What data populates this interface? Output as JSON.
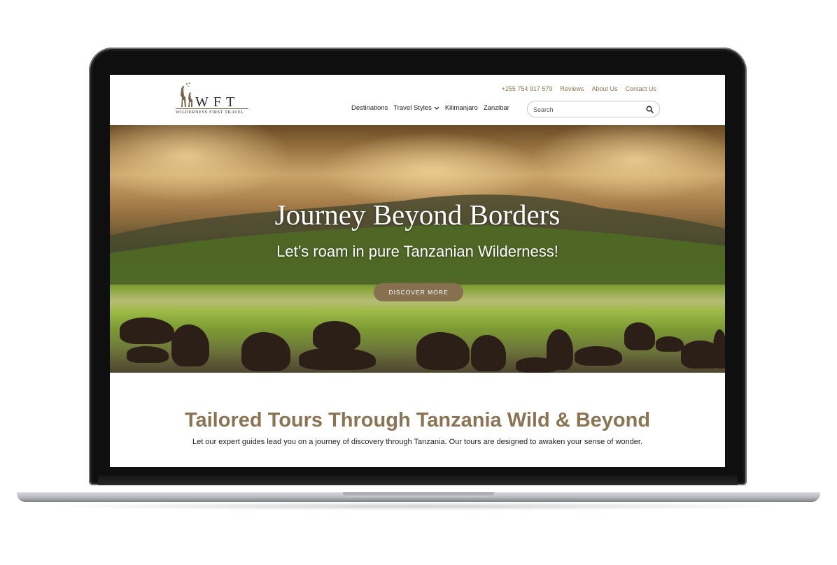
{
  "brand": {
    "logo_letters": "WFT",
    "logo_subtitle": "WILDERNESS FIRST TRAVEL",
    "accent_color": "#8a7453"
  },
  "topbar": {
    "phone": "+255 754 917 579",
    "reviews": "Reviews",
    "about": "About Us",
    "contact": "Contact Us"
  },
  "nav": {
    "destinations": "Destinations",
    "travel_styles": "Travel Styles",
    "kilimanjaro": "Kilimanjaro",
    "zanzibar": "Zanzibar"
  },
  "search": {
    "placeholder": "Search",
    "icon": "search-icon"
  },
  "hero": {
    "title": "Journey Beyond Borders",
    "subtitle": "Let’s roam in pure Tanzanian Wilderness!",
    "button": "DISCOVER MORE"
  },
  "intro": {
    "title": "Tailored Tours Through Tanzania Wild & Beyond",
    "text": "Let our expert guides lead you on a journey of discovery through Tanzania. Our tours are designed to awaken your sense of wonder."
  }
}
